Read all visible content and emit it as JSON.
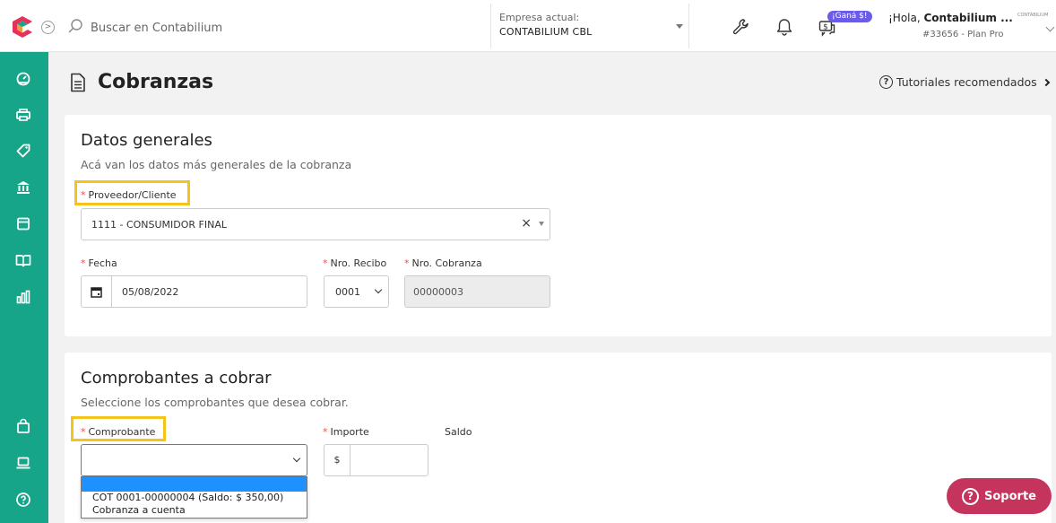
{
  "header": {
    "search_placeholder": "Buscar en Contabilium",
    "company_label": "Empresa actual:",
    "company_value": "CONTABILIUM CBL",
    "promo_badge": "¡Ganá $!",
    "greeting_prefix": "¡Hola, ",
    "user_name": "Contabilium ...",
    "plan": "#33656 - Plan Pro",
    "brand_mini": "CONTABILIUM"
  },
  "sidebar": {
    "items": [
      {
        "icon": "dashboard-icon"
      },
      {
        "icon": "printer-icon"
      },
      {
        "icon": "tag-icon"
      },
      {
        "icon": "bank-icon"
      },
      {
        "icon": "calendar-icon"
      },
      {
        "icon": "book-icon"
      },
      {
        "icon": "bar-chart-icon"
      },
      {
        "icon": "shopping-bag-icon"
      },
      {
        "icon": "laptop-icon"
      },
      {
        "icon": "help-icon"
      }
    ]
  },
  "page": {
    "title": "Cobranzas",
    "tutorials_link": "Tutoriales recomendados"
  },
  "datos_generales": {
    "title": "Datos generales",
    "subtitle": "Acá van los datos más generales de la cobranza",
    "proveedor_label": "Proveedor/Cliente",
    "proveedor_value": "1111 - CONSUMIDOR FINAL",
    "fecha_label": "Fecha",
    "fecha_value": "05/08/2022",
    "nro_recibo_label": "Nro. Recibo",
    "nro_recibo_value": "0001",
    "nro_cobranza_label": "Nro. Cobranza",
    "nro_cobranza_value": "00000003"
  },
  "comprobantes": {
    "title": "Comprobantes a cobrar",
    "subtitle": "Seleccione los comprobantes que desea cobrar.",
    "comprobante_label": "Comprobante",
    "importe_label": "Importe",
    "importe_prefix": "$",
    "saldo_label": "Saldo",
    "options": [
      "COT 0001-00000004 (Saldo: $ 350,00)",
      "Cobranza a cuenta"
    ]
  },
  "support": {
    "label": "Soporte"
  },
  "colors": {
    "sidebar": "#17a589",
    "highlight": "#f3c41c",
    "support": "#c4345c",
    "required": "#e0534a",
    "selected_option": "#1e90ff"
  }
}
